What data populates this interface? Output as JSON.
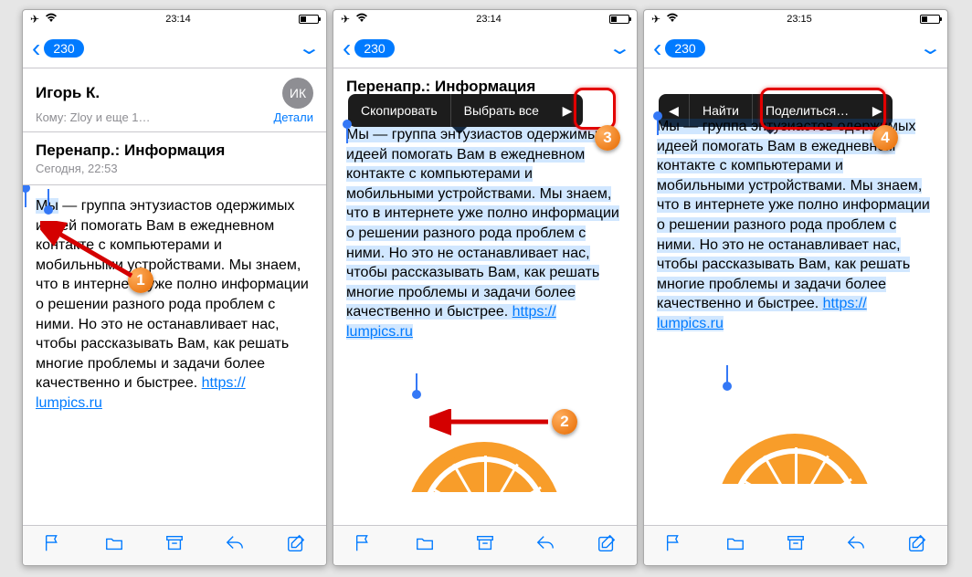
{
  "status": {
    "time1": "23:14",
    "time2": "23:14",
    "time3": "23:15"
  },
  "nav": {
    "badge": "230"
  },
  "header": {
    "sender": "Игорь К.",
    "avatar": "ИК",
    "to_prefix": "Кому:",
    "to": "Zloy и еще 1…",
    "details": "Детали"
  },
  "subject": {
    "title": "Перенапр.: Информация",
    "date": "Сегодня, 22:53"
  },
  "body": {
    "word_sel": "Мы",
    "rest1": " — группа энтузиастов одержимых идеей помогать Вам в ежедневном контакте с компьютерами и мобильными устройствами. Мы знаем, что в интернете уже полно информации о решении разного рода проблем с ними. Но это не останавливает нас, чтобы рассказывать Вам, как решать многие проблемы и задачи более качественно и быстрее. ",
    "full_text": "Мы — группа энтузиастов одержимых идеей помогать Вам в ежедневном контакте с компьютерами и мобильными устройствами. Мы знаем, что в интернете уже полно информации о решении разного рода проблем с ними. Но это не останавливает нас, чтобы рассказывать Вам, как решать многие проблемы и задачи более качественно и быстрее. ",
    "link_label": "https://lumpics.ru",
    "link_p1a": "https://",
    "link_p1b": "lumpics.ru"
  },
  "menu": {
    "copy": "Скопировать",
    "select_all": "Выбрать все",
    "find": "Найти",
    "share": "Поделиться…"
  },
  "callouts": {
    "c1": "1",
    "c2": "2",
    "c3": "3",
    "c4": "4"
  }
}
